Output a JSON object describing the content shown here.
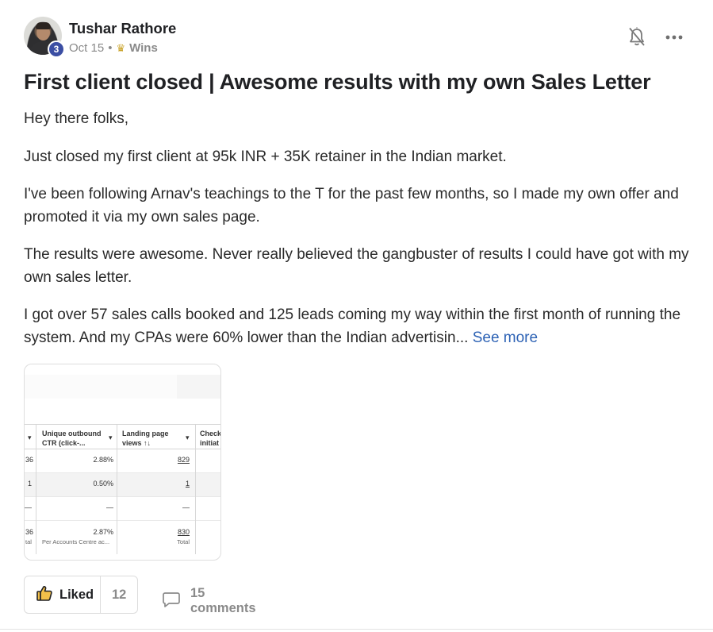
{
  "post": {
    "author": {
      "name": "Tushar Rathore",
      "level": "3",
      "avatar_icon": "user-avatar"
    },
    "meta": {
      "date": "Oct 15",
      "separator": "•",
      "category_icon": "crown-icon",
      "category": "Wins"
    },
    "title": "First client closed | Awesome results with my own Sales Letter",
    "paragraphs": [
      "Hey there folks,",
      "Just closed my first client at 95k INR + 35K retainer in the Indian market.",
      "I've been following Arnav's teachings to the T for the past few months, so I made my own offer and promoted it via my own sales page.",
      "The results were awesome. Never really believed the gangbuster of results I could have got with my own sales letter.",
      "I got over 57 sales calls booked and 125 leads coming my way within the first month of running the system. And my CPAs were 60% lower than the Indian advertisin..."
    ],
    "see_more": "See more"
  },
  "attachment": {
    "headers": {
      "col2_line1": "Unique outbound",
      "col2_line2": "CTR (click-...",
      "col3_line1": "Landing page",
      "col3_line2": "views ↑↓",
      "col4_line1": "Check",
      "col4_line2": "initiat"
    },
    "rows": [
      {
        "c1": "36",
        "c2": "2.88%",
        "c3": "829"
      },
      {
        "c1": "1",
        "c2": "0.50%",
        "c3": "1"
      },
      {
        "c1": "—",
        "c2": "—",
        "c3": "—"
      }
    ],
    "total": {
      "c1": "36",
      "c1_sub": "tal",
      "c2": "2.87%",
      "c2_sub": "Per Accounts Centre ac...",
      "c3": "830",
      "c3_sub": "Total"
    }
  },
  "actions": {
    "like_label": "Liked",
    "like_count": "12",
    "comments_label": "15 comments"
  },
  "colors": {
    "link": "#2e63b5",
    "badge": "#3b4ea3",
    "crown": "#c9a227"
  }
}
